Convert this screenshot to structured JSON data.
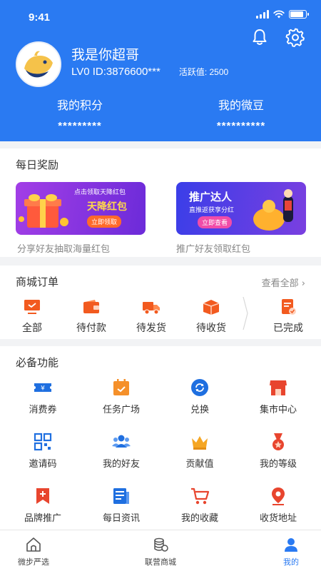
{
  "status_bar": {
    "time": "9:41",
    "battery_level": 0.85
  },
  "header": {
    "user_name": "我是你超哥",
    "user_id": "LV0 ID:3876600***",
    "activity_label": "活跃值: 2500",
    "stats": [
      {
        "label": "我的积分",
        "value": "*********"
      },
      {
        "label": "我的微豆",
        "value": "**********"
      }
    ],
    "icons": [
      "bell-icon",
      "gear-icon"
    ]
  },
  "daily_reward": {
    "title": "每日奖励",
    "banners": [
      {
        "top_text": "点击领取天降红包",
        "main_text": "天降红包",
        "button": "立即领取",
        "caption": "分享好友抽取海量红包"
      },
      {
        "top_text": "推广达人",
        "main_text": "直推返获享分红",
        "button": "立即查看",
        "caption": "推广好友领取红包"
      }
    ]
  },
  "orders": {
    "title": "商城订单",
    "view_all": "查看全部",
    "items": [
      {
        "label": "全部",
        "icon": "monitor-icon"
      },
      {
        "label": "待付款",
        "icon": "wallet-icon"
      },
      {
        "label": "待发货",
        "icon": "truck-icon"
      },
      {
        "label": "待收货",
        "icon": "box-icon"
      },
      {
        "label": "已完成",
        "icon": "completed-doc-icon"
      }
    ]
  },
  "features": {
    "title": "必备功能",
    "items": [
      {
        "label": "消费券",
        "icon": "coupon-icon"
      },
      {
        "label": "任务广场",
        "icon": "calendar-icon"
      },
      {
        "label": "兑换",
        "icon": "exchange-icon"
      },
      {
        "label": "集市中心",
        "icon": "store-icon"
      },
      {
        "label": "邀请码",
        "icon": "qrcode-icon"
      },
      {
        "label": "我的好友",
        "icon": "friends-icon"
      },
      {
        "label": "贡献值",
        "icon": "crown-icon"
      },
      {
        "label": "我的等级",
        "icon": "medal-icon"
      },
      {
        "label": "品牌推广",
        "icon": "bookmark-plus-icon"
      },
      {
        "label": "每日资讯",
        "icon": "news-icon"
      },
      {
        "label": "我的收藏",
        "icon": "cart-icon"
      },
      {
        "label": "收货地址",
        "icon": "location-icon"
      }
    ]
  },
  "bottom_nav": {
    "active_color": "#2a7af2",
    "items": [
      {
        "label": "微步严选",
        "icon": "home-icon"
      },
      {
        "label": "联营商城",
        "icon": "coins-icon"
      },
      {
        "label": "我的",
        "icon": "user-icon"
      }
    ]
  },
  "colors": {
    "brand_blue": "#2a7af2",
    "accent_orange": "#f25a1f"
  }
}
